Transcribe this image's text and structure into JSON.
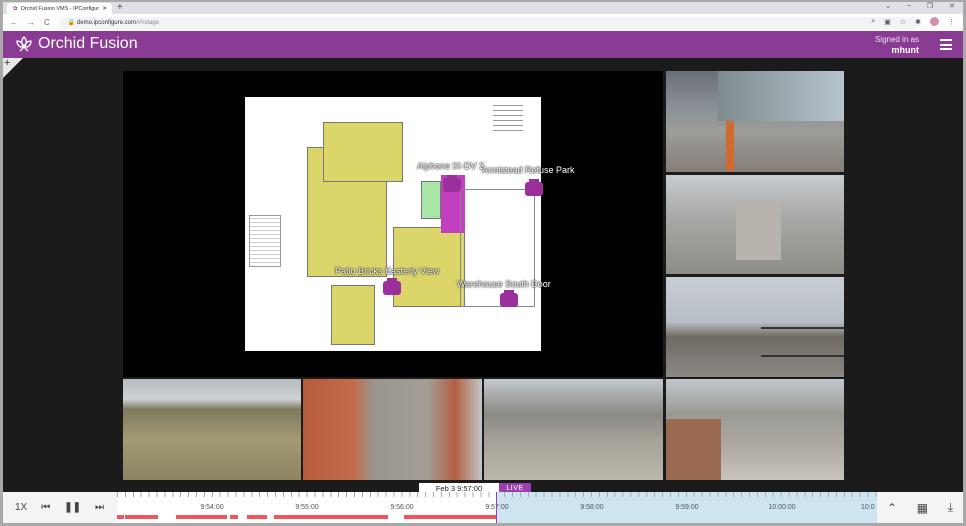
{
  "browser": {
    "tab_title": "Orchid Fusion VMS - IPConfigur",
    "url_host": "demo.ipconfigure.com",
    "url_path": "/#!/stage"
  },
  "header": {
    "app_name": "Orchid Fusion",
    "signed_in_label": "Signed in as",
    "username": "mhunt"
  },
  "stage": {
    "add_label": "+"
  },
  "map": {
    "cameras": [
      {
        "label": "Aiphone IX-DV 2"
      },
      {
        "label": "Armistead Refuse Park"
      },
      {
        "label": "Patio Bricks Easterly View"
      },
      {
        "label": "Warehouse South Door"
      }
    ]
  },
  "timeline": {
    "speed": "1X",
    "current": "Feb 3 9:57:00",
    "live_label": "LIVE",
    "labels": [
      "9:54:00",
      "9:55:00",
      "9:56:00",
      "9:57:00",
      "9:58:00",
      "9:59:00",
      "10:00:00",
      "10:0"
    ]
  },
  "colors": {
    "brand": "#8a3b93",
    "recording": "#f2545b",
    "future": "#cce5f0"
  }
}
